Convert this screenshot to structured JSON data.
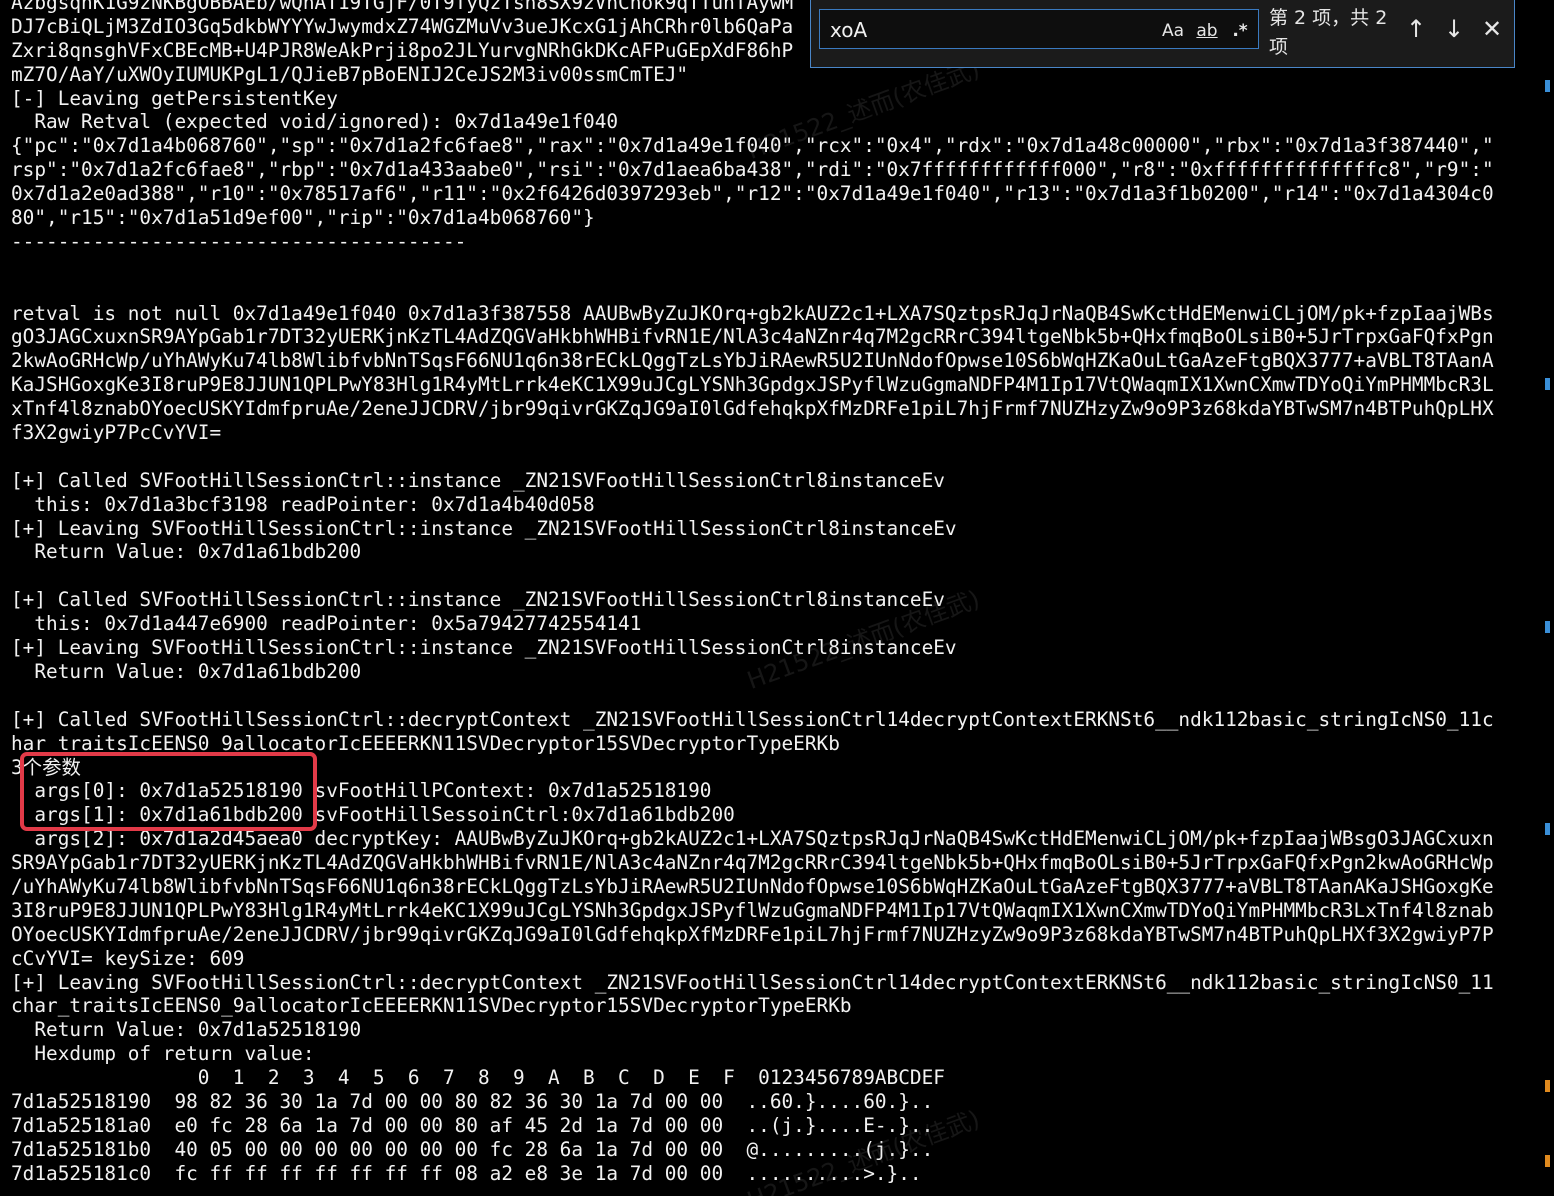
{
  "terminal": {
    "lines": [
      "AzbgsqhK1G9zNKBgOBBAEb/wQnAT19TGjF/0T9TyQzTsh8SX9zVnCnok9qTTunTAywM",
      "DJ7cBiQLjM3ZdIO3Gq5dkbWYYYwJwymdxZ74WGZMuVv3ueJKcxG1jAhCRhr0lb6QaPa",
      "Zxri8qnsghVFxCBEcMB+U4PJR8WeAkPrji8po2JLYurvgNRhGkDKcAFPuGEpXdF86hP",
      "mZ7O/AaY/uXWOyIUMUKPgL1/QJieB7pBoENIJ2CeJS2M3iv00ssmCmTEJ\"",
      "[-] Leaving getPersistentKey",
      "  Raw Retval (expected void/ignored): 0x7d1a49e1f040",
      "{\"pc\":\"0x7d1a4b068760\",\"sp\":\"0x7d1a2fc6fae8\",\"rax\":\"0x7d1a49e1f040\",\"rcx\":\"0x4\",\"rdx\":\"0x7d1a48c00000\",\"rbx\":\"0x7d1a3f387440\",\"",
      "rsp\":\"0x7d1a2fc6fae8\",\"rbp\":\"0x7d1a433aabe0\",\"rsi\":\"0x7d1aea6ba438\",\"rdi\":\"0x7ffffffffffff000\",\"r8\":\"0xffffffffffffffc8\",\"r9\":\"",
      "0x7d1a2e0ad388\",\"r10\":\"0x78517af6\",\"r11\":\"0x2f6426d0397293eb\",\"r12\":\"0x7d1a49e1f040\",\"r13\":\"0x7d1a3f1b0200\",\"r14\":\"0x7d1a4304c0",
      "80\",\"r15\":\"0x7d1a51d9ef00\",\"rip\":\"0x7d1a4b068760\"}",
      "---------------------------------------",
      "",
      "",
      "retval is not null 0x7d1a49e1f040 0x7d1a3f387558 AAUBwByZuJKOrq+gb2kAUZ2c1+LXA7SQztpsRJqJrNaQB4SwKctHdEMenwiCLjOM/pk+fzpIaajWBs",
      "gO3JAGCxuxnSR9AYpGab1r7DT32yUERKjnKzTL4AdZQGVaHkbhWHBifvRN1E/NlA3c4aNZnr4q7M2gcRRrC394ltgeNbk5b+QHxfmqBoOLsiB0+5JrTrpxGaFQfxPgn",
      "2kwAoGRHcWp/uYhAWyKu74lb8WlibfvbNnTSqsF66NU1q6n38rECkLQggTzLsYbJiRAewR5U2IUnNdofOpwse10S6bWqHZKaOuLtGaAzeFtgBQX3777+aVBLT8TAanA",
      "KaJSHGoxgKe3I8ruP9E8JJUN1QPLPwY83Hlg1R4yMtLrrk4eKC1X99uJCgLYSNh3GpdgxJSPyflWzuGgmaNDFP4M1Ip17VtQWaqmIX1XwnCXmwTDYoQiYmPHMMbcR3L",
      "xTnf4l8znabOYoecUSKYIdmfpruAe/2eneJJCDRV/jbr99qivrGKZqJG9aI0lGdfehqkpXfMzDRFe1piL7hjFrmf7NUZHzyZw9o9P3z68kdaYBTwSM7n4BTPuhQpLHX",
      "f3X2gwiyP7PcCvYVI=",
      "",
      "[+] Called SVFootHillSessionCtrl::instance _ZN21SVFootHillSessionCtrl8instanceEv",
      "  this: 0x7d1a3bcf3198 readPointer: 0x7d1a4b40d058",
      "[+] Leaving SVFootHillSessionCtrl::instance _ZN21SVFootHillSessionCtrl8instanceEv",
      "  Return Value: 0x7d1a61bdb200",
      "",
      "[+] Called SVFootHillSessionCtrl::instance _ZN21SVFootHillSessionCtrl8instanceEv",
      "  this: 0x7d1a447e6900 readPointer: 0x5a79427742554141",
      "[+] Leaving SVFootHillSessionCtrl::instance _ZN21SVFootHillSessionCtrl8instanceEv",
      "  Return Value: 0x7d1a61bdb200",
      "",
      "[+] Called SVFootHillSessionCtrl::decryptContext _ZN21SVFootHillSessionCtrl14decryptContextERKNSt6__ndk112basic_stringIcNS0_11c",
      "har_traitsIcEENS0_9allocatorIcEEEERKN11SVDecryptor15SVDecryptorTypeERKb",
      "3个参数",
      "  args[0]: 0x7d1a52518190 svFootHillPContext: 0x7d1a52518190",
      "  args[1]: 0x7d1a61bdb200 svFootHillSessoinCtrl:0x7d1a61bdb200",
      "  args[2]: 0x7d1a2d45aea0 decryptKey: AAUBwByZuJKOrq+gb2kAUZ2c1+LXA7SQztpsRJqJrNaQB4SwKctHdEMenwiCLjOM/pk+fzpIaajWBsgO3JAGCxuxn",
      "SR9AYpGab1r7DT32yUERKjnKzTL4AdZQGVaHkbhWHBifvRN1E/NlA3c4aNZnr4q7M2gcRRrC394ltgeNbk5b+QHxfmqBoOLsiB0+5JrTrpxGaFQfxPgn2kwAoGRHcWp",
      "/uYhAWyKu74lb8WlibfvbNnTSqsF66NU1q6n38rECkLQggTzLsYbJiRAewR5U2IUnNdofOpwse10S6bWqHZKaOuLtGaAzeFtgBQX3777+aVBLT8TAanAKaJSHGoxgKe",
      "3I8ruP9E8JJUN1QPLPwY83Hlg1R4yMtLrrk4eKC1X99uJCgLYSNh3GpdgxJSPyflWzuGgmaNDFP4M1Ip17VtQWaqmIX1XwnCXmwTDYoQiYmPHMMbcR3LxTnf4l8znab",
      "OYoecUSKYIdmfpruAe/2eneJJCDRV/jbr99qivrGKZqJG9aI0lGdfehqkpXfMzDRFe1piL7hjFrmf7NUZHzyZw9o9P3z68kdaYBTwSM7n4BTPuhQpLHXf3X2gwiyP7P",
      "cCvYVI= keySize: 609",
      "[+] Leaving SVFootHillSessionCtrl::decryptContext _ZN21SVFootHillSessionCtrl14decryptContextERKNSt6__ndk112basic_stringIcNS0_11",
      "char_traitsIcEENS0_9allocatorIcEEEERKN11SVDecryptor15SVDecryptorTypeERKb",
      "  Return Value: 0x7d1a52518190",
      "  Hexdump of return value:",
      "                0  1  2  3  4  5  6  7  8  9  A  B  C  D  E  F  0123456789ABCDEF",
      "7d1a52518190  98 82 36 30 1a 7d 00 00 80 82 36 30 1a 7d 00 00  ..60.}....60.}..",
      "7d1a525181a0  e0 fc 28 6a 1a 7d 00 00 80 af 45 2d 1a 7d 00 00  ..(j.}....E-.}..",
      "7d1a525181b0  40 05 00 00 00 00 00 00 00 fc 28 6a 1a 7d 00 00  @.........(j.}..",
      "7d1a525181c0  fc ff ff ff ff ff ff ff 08 a2 e8 3e 1a 7d 00 00  ..........>.}.."
    ]
  },
  "find": {
    "query": "xoA",
    "match_case_label": "Aa",
    "whole_word_label": "ab",
    "regex_label": ".*",
    "match_count": "第 2 项，共 2 项",
    "prev_icon": "↑",
    "next_icon": "↓",
    "close_icon": "✕"
  },
  "colors": {
    "background": "#000000",
    "text": "#f2f2f2",
    "highlight_box": "#e23a48",
    "find_border": "#4a86c8"
  },
  "watermark": "H21522_述而(农佳武)"
}
